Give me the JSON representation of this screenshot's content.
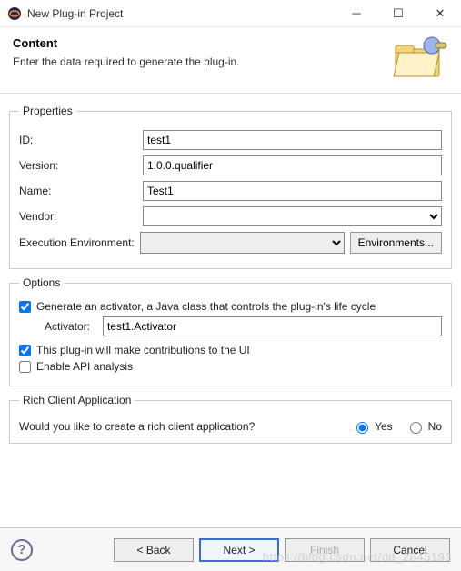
{
  "titlebar": {
    "title": "New Plug-in Project"
  },
  "banner": {
    "heading": "Content",
    "description": "Enter the data required to generate the plug-in."
  },
  "properties": {
    "legend": "Properties",
    "id_label": "ID:",
    "id_value": "test1",
    "version_label": "Version:",
    "version_value": "1.0.0.qualifier",
    "name_label": "Name:",
    "name_value": "Test1",
    "vendor_label": "Vendor:",
    "vendor_value": "",
    "env_label": "Execution Environment:",
    "env_button": "Environments..."
  },
  "options": {
    "legend": "Options",
    "generate_activator": "Generate an activator, a Java class that controls the plug-in's life cycle",
    "activator_label": "Activator:",
    "activator_value": "test1.Activator",
    "ui_contrib": "This plug-in will make contributions to the UI",
    "api_analysis": "Enable API analysis"
  },
  "rich": {
    "legend": "Rich Client Application",
    "question": "Would you like to create a rich client application?",
    "yes": "Yes",
    "no": "No"
  },
  "footer": {
    "back": "< Back",
    "next": "Next >",
    "finish": "Finish",
    "cancel": "Cancel"
  },
  "watermark": "https://blog.csdn.net/dd_2845193"
}
